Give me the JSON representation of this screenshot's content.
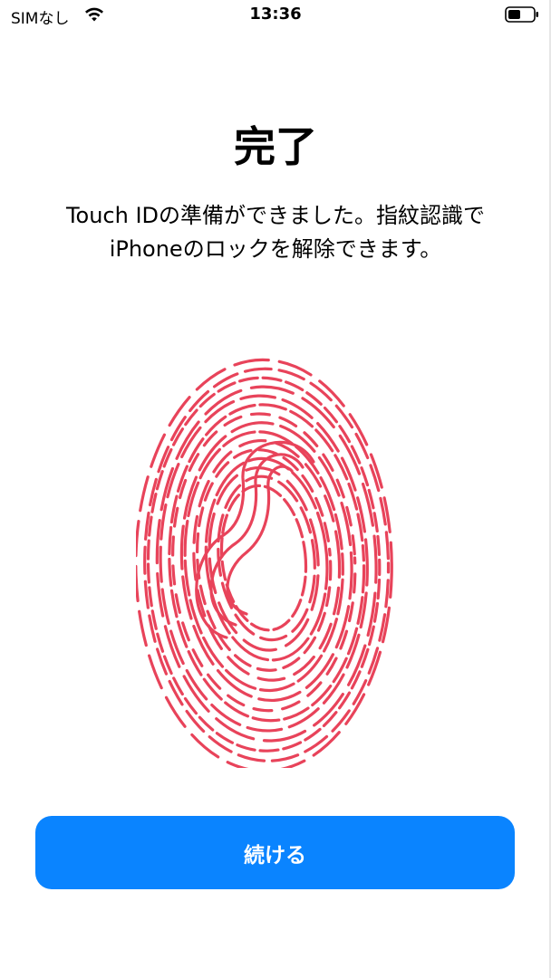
{
  "status_bar": {
    "carrier": "SIMなし",
    "time": "13:36",
    "icons": [
      "wifi-icon",
      "battery-icon"
    ]
  },
  "main": {
    "title": "完了",
    "subtitle_line1": "Touch IDの準備ができました。指紋認識で",
    "subtitle_line2": "iPhoneのロックを解除できます。"
  },
  "fingerprint": {
    "icon": "fingerprint-icon",
    "color": "#e8435a"
  },
  "actions": {
    "continue_label": "続ける",
    "button_color": "#0a84ff"
  }
}
